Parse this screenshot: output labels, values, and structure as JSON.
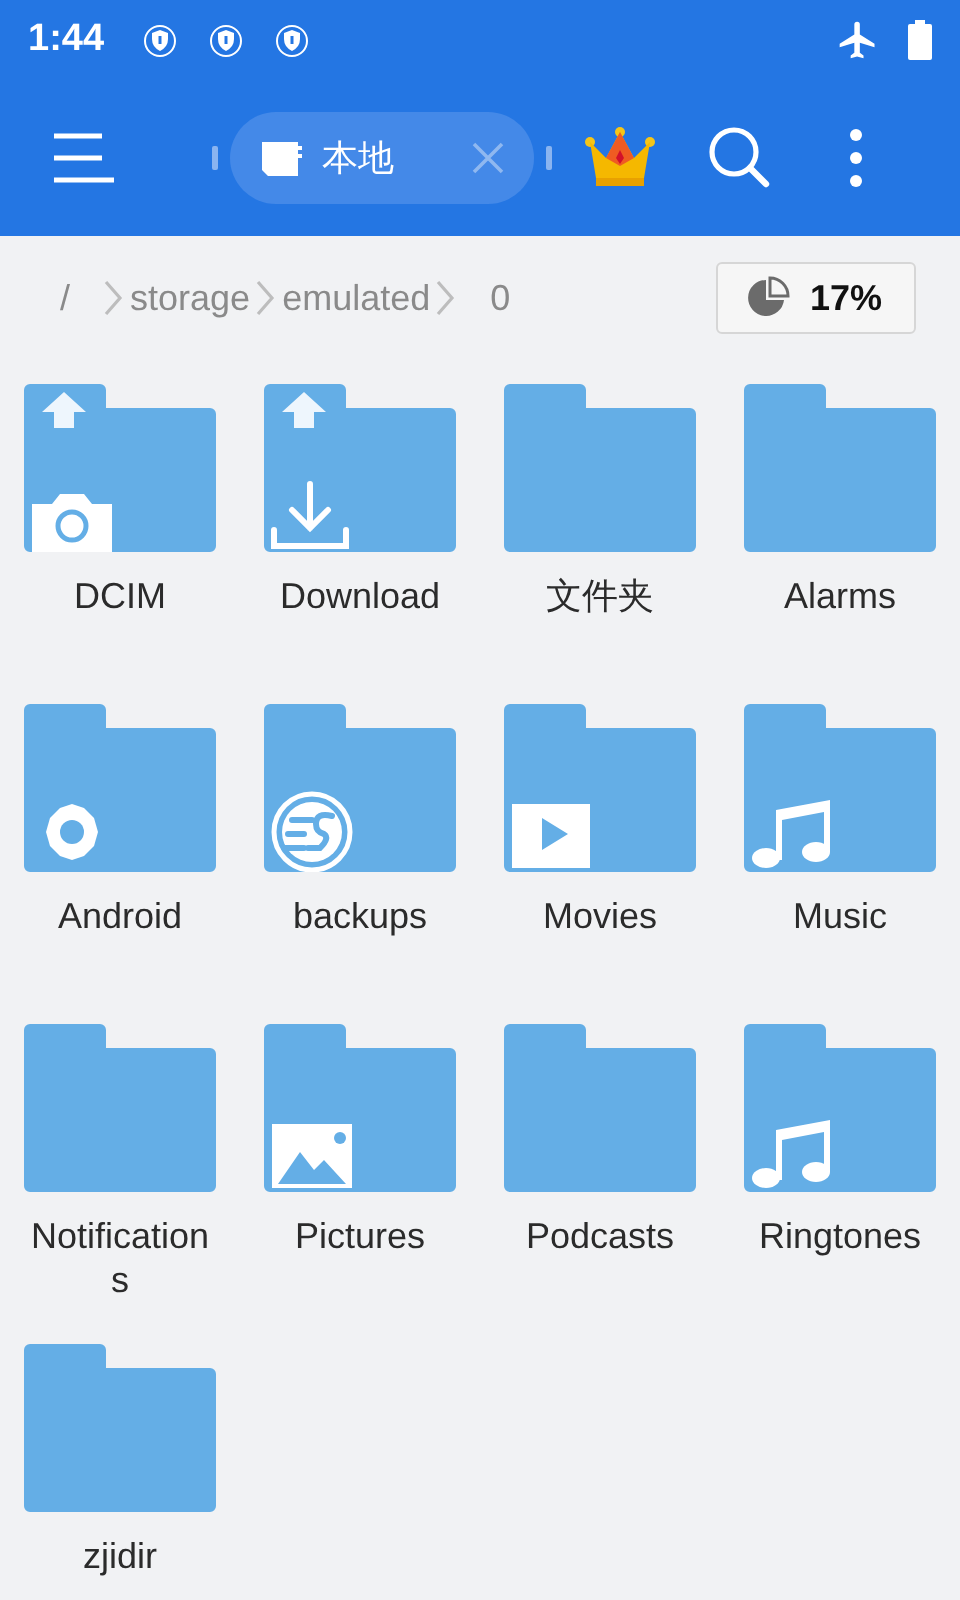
{
  "status_bar": {
    "time": "1:44"
  },
  "toolbar": {
    "tab": {
      "label": "本地",
      "selected": true
    }
  },
  "breadcrumb": [
    "/",
    "storage",
    "emulated",
    "0"
  ],
  "storage": {
    "reading": "17%"
  },
  "folders": [
    {
      "name": "DCIM",
      "kind": "camera",
      "upload_mark": true
    },
    {
      "name": "Download",
      "kind": "download",
      "upload_mark": true
    },
    {
      "name": "文件夹",
      "kind": "plain",
      "upload_mark": false
    },
    {
      "name": "Alarms",
      "kind": "plain",
      "upload_mark": false
    },
    {
      "name": "Android",
      "kind": "gear",
      "upload_mark": false
    },
    {
      "name": "backups",
      "kind": "es",
      "upload_mark": false
    },
    {
      "name": "Movies",
      "kind": "video",
      "upload_mark": false
    },
    {
      "name": "Music",
      "kind": "music",
      "upload_mark": false
    },
    {
      "name": "Notifications",
      "kind": "plain",
      "upload_mark": false
    },
    {
      "name": "Pictures",
      "kind": "image",
      "upload_mark": false
    },
    {
      "name": "Podcasts",
      "kind": "plain",
      "upload_mark": false
    },
    {
      "name": "Ringtones",
      "kind": "music",
      "upload_mark": false
    },
    {
      "name": "zjidir",
      "kind": "plain",
      "upload_mark": false
    }
  ]
}
